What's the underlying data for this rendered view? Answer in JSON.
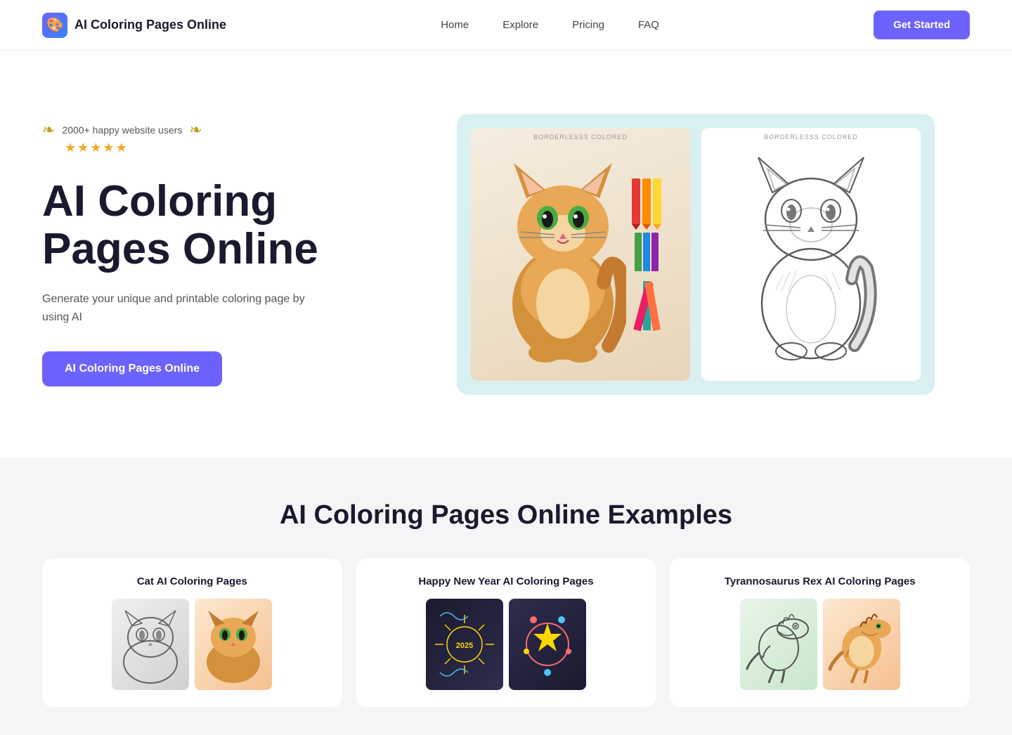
{
  "nav": {
    "logo_icon": "🎨",
    "logo_text": "AI Coloring Pages Online",
    "links": [
      {
        "label": "Home",
        "id": "home"
      },
      {
        "label": "Explore",
        "id": "explore"
      },
      {
        "label": "Pricing",
        "id": "pricing"
      },
      {
        "label": "FAQ",
        "id": "faq"
      }
    ],
    "cta_label": "Get Started"
  },
  "hero": {
    "social_proof_text": "2000+ happy website users",
    "stars": "★★★★★",
    "title": "AI Coloring Pages Online",
    "subtitle": "Generate your unique and printable coloring page by using AI",
    "cta_label": "AI Coloring Pages Online",
    "image_label_left": "BORDERLESSS COLORED",
    "image_label_right": "BORDERLESSS COLORED"
  },
  "examples": {
    "section_title": "AI Coloring Pages Online Examples",
    "cards": [
      {
        "title": "Cat AI Coloring Pages",
        "id": "cat"
      },
      {
        "title": "Happy New Year AI Coloring Pages",
        "id": "nye"
      },
      {
        "title": "Tyrannosaurus Rex AI Coloring Pages",
        "id": "dino"
      }
    ]
  },
  "colors": {
    "accent": "#6c63ff",
    "bg_section": "#f5f5f7"
  }
}
